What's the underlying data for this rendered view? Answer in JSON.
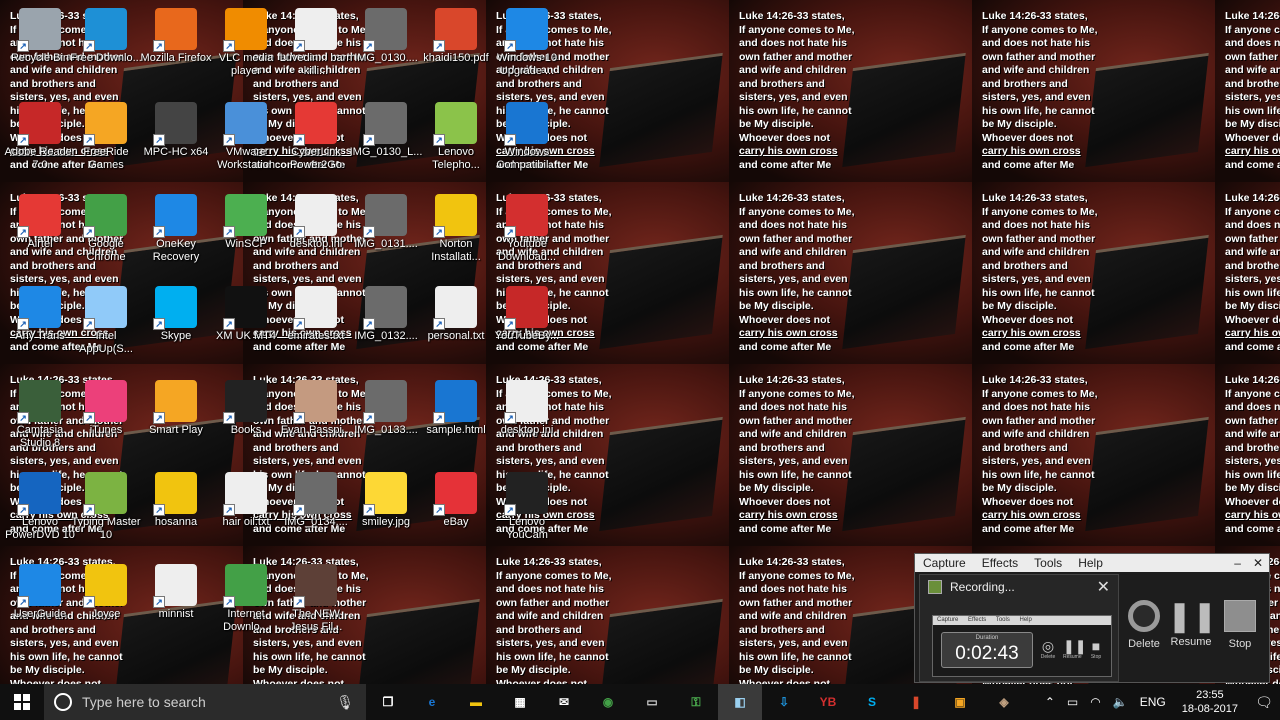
{
  "wallpaper": {
    "verse_lines": [
      "Luke 14:26-33 states,",
      "If anyone comes to Me,",
      "and does not hate his",
      "own father and mother",
      "and wife and children",
      "and brothers and",
      "sisters, yes, and even",
      "his own life, he cannot",
      "be My disciple.",
      "Whoever does not",
      "carry his own cross",
      "and come after Me"
    ]
  },
  "desktop_icons": [
    {
      "label": "Recycle Bin",
      "icon": "recycle-bin-icon",
      "color": "#9aa4ad"
    },
    {
      "label": "Free Downlo...",
      "icon": "download-icon",
      "color": "#1e90d6"
    },
    {
      "label": "Mozilla Firefox",
      "icon": "firefox-icon",
      "color": "#e8681c"
    },
    {
      "label": "VLC media player",
      "icon": "vlc-icon",
      "color": "#f08c00"
    },
    {
      "label": "Luvedin... barn killi...",
      "icon": "text-file-icon",
      "color": "#eeeeee"
    },
    {
      "label": "IMG_0130....",
      "icon": "photo-icon",
      "color": "#6b6b6b"
    },
    {
      "label": "khaidi150.pdf",
      "icon": "pdf-icon",
      "color": "#d9472b"
    },
    {
      "label": "Windows 10 Upgrade ...",
      "icon": "windows-icon",
      "color": "#1e88e5"
    },
    {
      "label": "Adobe Reader 7.0",
      "icon": "adobe-reader-icon",
      "color": "#c62828"
    },
    {
      "label": "FreeRide Games",
      "icon": "freeride-icon",
      "color": "#f5a623"
    },
    {
      "label": "MPC-HC x64",
      "icon": "mpc-icon",
      "color": "#444444"
    },
    {
      "label": "VMware Workstation",
      "icon": "vmware-icon",
      "color": "#4a90d9"
    },
    {
      "label": "CyberLink Power2Go",
      "icon": "power2go-icon",
      "color": "#e53935"
    },
    {
      "label": "IMG_0130_L...",
      "icon": "photo-icon",
      "color": "#6b6b6b"
    },
    {
      "label": "Lenovo Telepho...",
      "icon": "lenovo-phone-icon",
      "color": "#8bc34a"
    },
    {
      "label": "Windows Compatibil...",
      "icon": "edge-icon",
      "color": "#1976d2"
    },
    {
      "label": "Airtel",
      "icon": "airtel-icon",
      "color": "#e53935"
    },
    {
      "label": "Google Chrome",
      "icon": "chrome-icon",
      "color": "#43a047"
    },
    {
      "label": "OneKey Recovery",
      "icon": "onekey-icon",
      "color": "#1e88e5"
    },
    {
      "label": "WinSCP",
      "icon": "winscp-icon",
      "color": "#4caf50"
    },
    {
      "label": "desktop.ini",
      "icon": "text-file-icon",
      "color": "#eeeeee"
    },
    {
      "label": "IMG_0131....",
      "icon": "photo-icon",
      "color": "#6b6b6b"
    },
    {
      "label": "Norton Installati...",
      "icon": "folder-icon",
      "color": "#f1c40f"
    },
    {
      "label": "Youtube Download...",
      "icon": "youtube-downloader-icon",
      "color": "#d32f2f"
    },
    {
      "label": "Any Trans",
      "icon": "anytrans-icon",
      "color": "#1e88e5"
    },
    {
      "label": "Intel AppUp(S...",
      "icon": "intel-appup-icon",
      "color": "#90caf9"
    },
    {
      "label": "Skype",
      "icon": "skype-icon",
      "color": "#00aff0"
    },
    {
      "label": "XM UK MT4",
      "icon": "xm-icon",
      "color": "#111111"
    },
    {
      "label": "emirates.txt",
      "icon": "text-file-icon",
      "color": "#eeeeee"
    },
    {
      "label": "IMG_0132....",
      "icon": "photo-icon",
      "color": "#6b6b6b"
    },
    {
      "label": "personal.txt",
      "icon": "text-file-icon",
      "color": "#eeeeee"
    },
    {
      "label": "YouTubeBy...",
      "icon": "youtube-byclick-icon",
      "color": "#c62828"
    },
    {
      "label": "Camtasia Studio 8",
      "icon": "camtasia-icon",
      "color": "#3a5f3a"
    },
    {
      "label": "iTunes",
      "icon": "itunes-icon",
      "color": "#ec407a"
    },
    {
      "label": "Smart Play",
      "icon": "smart-play-icon",
      "color": "#f5a623"
    },
    {
      "label": "Books",
      "icon": "folder-icon",
      "color": "#222222"
    },
    {
      "label": "Evan Passpi...",
      "icon": "photo-icon",
      "color": "#c49a80"
    },
    {
      "label": "IMG_0133....",
      "icon": "photo-icon",
      "color": "#6b6b6b"
    },
    {
      "label": "sample.html",
      "icon": "edge-icon",
      "color": "#1976d2"
    },
    {
      "label": "desktop.ini",
      "icon": "text-file-icon",
      "color": "#eeeeee"
    },
    {
      "label": "Lenovo PowerDVD 10",
      "icon": "powerdvd-icon",
      "color": "#1565c0"
    },
    {
      "label": "Typing Master 10",
      "icon": "typing-master-icon",
      "color": "#7cb342"
    },
    {
      "label": "hosanna",
      "icon": "folder-icon",
      "color": "#f1c40f"
    },
    {
      "label": "hair oil.txt",
      "icon": "text-file-icon",
      "color": "#eeeeee"
    },
    {
      "label": "IMG_0134....",
      "icon": "photo-icon",
      "color": "#6b6b6b"
    },
    {
      "label": "smiley.jpg",
      "icon": "smiley-icon",
      "color": "#fdd835"
    },
    {
      "label": "eBay",
      "icon": "ebay-icon",
      "color": "#e53238"
    },
    {
      "label": "Lenovo YouCam",
      "icon": "youcam-icon",
      "color": "#222222"
    },
    {
      "label": "UserGuide",
      "icon": "lenovo-userguide-icon",
      "color": "#1e88e5"
    },
    {
      "label": "Joyce",
      "icon": "folder-icon",
      "color": "#f1c40f"
    },
    {
      "label": "minnist",
      "icon": "text-file-icon",
      "color": "#eeeeee"
    },
    {
      "label": "Internet Downlo...",
      "icon": "idm-icon",
      "color": "#43a047"
    },
    {
      "label": "The NEW Jesus Fil...",
      "icon": "video-file-icon",
      "color": "#5d4037"
    }
  ],
  "recorder": {
    "menu": [
      "Capture",
      "Effects",
      "Tools",
      "Help"
    ],
    "window_min": "–",
    "window_close": "✕",
    "popup_title": "Recording...",
    "popup_close": "✕",
    "mini_menu": [
      "Capture",
      "Effects",
      "Tools",
      "Help"
    ],
    "duration_label": "Duration",
    "duration_value": "0:02:43",
    "mini_controls": [
      "Delete",
      "Resume",
      "Stop"
    ],
    "controls": {
      "delete": "Delete",
      "resume": "Resume",
      "stop": "Stop"
    }
  },
  "taskbar": {
    "search_placeholder": "Type here to search",
    "apps": [
      {
        "name": "task-view",
        "glyph": "❐",
        "color": "#ffffff"
      },
      {
        "name": "edge",
        "glyph": "e",
        "color": "#1976d2"
      },
      {
        "name": "file-explorer",
        "glyph": "▬",
        "color": "#f1c40f"
      },
      {
        "name": "store",
        "glyph": "▦",
        "color": "#ffffff"
      },
      {
        "name": "mail",
        "glyph": "✉",
        "color": "#ffffff"
      },
      {
        "name": "chrome",
        "glyph": "◉",
        "color": "#43a047"
      },
      {
        "name": "terminal",
        "glyph": "▭",
        "color": "#cccccc"
      },
      {
        "name": "winscp",
        "glyph": "⚿",
        "color": "#4caf50"
      },
      {
        "name": "camtasia",
        "glyph": "◧",
        "color": "#9ad0f0"
      },
      {
        "name": "download-app",
        "glyph": "⇩",
        "color": "#1e90d6"
      },
      {
        "name": "youtube-byclick",
        "glyph": "YB",
        "color": "#d32f2f"
      },
      {
        "name": "skype",
        "glyph": "S",
        "color": "#00aff0"
      },
      {
        "name": "pdf-app",
        "glyph": "❚",
        "color": "#d9472b"
      },
      {
        "name": "vmware",
        "glyph": "▣",
        "color": "#f5a623"
      },
      {
        "name": "camtasia-recorder",
        "glyph": "◈",
        "color": "#c0a080"
      }
    ],
    "tray": {
      "language": "ENG",
      "time": "23:55",
      "date": "18-08-2017"
    }
  }
}
